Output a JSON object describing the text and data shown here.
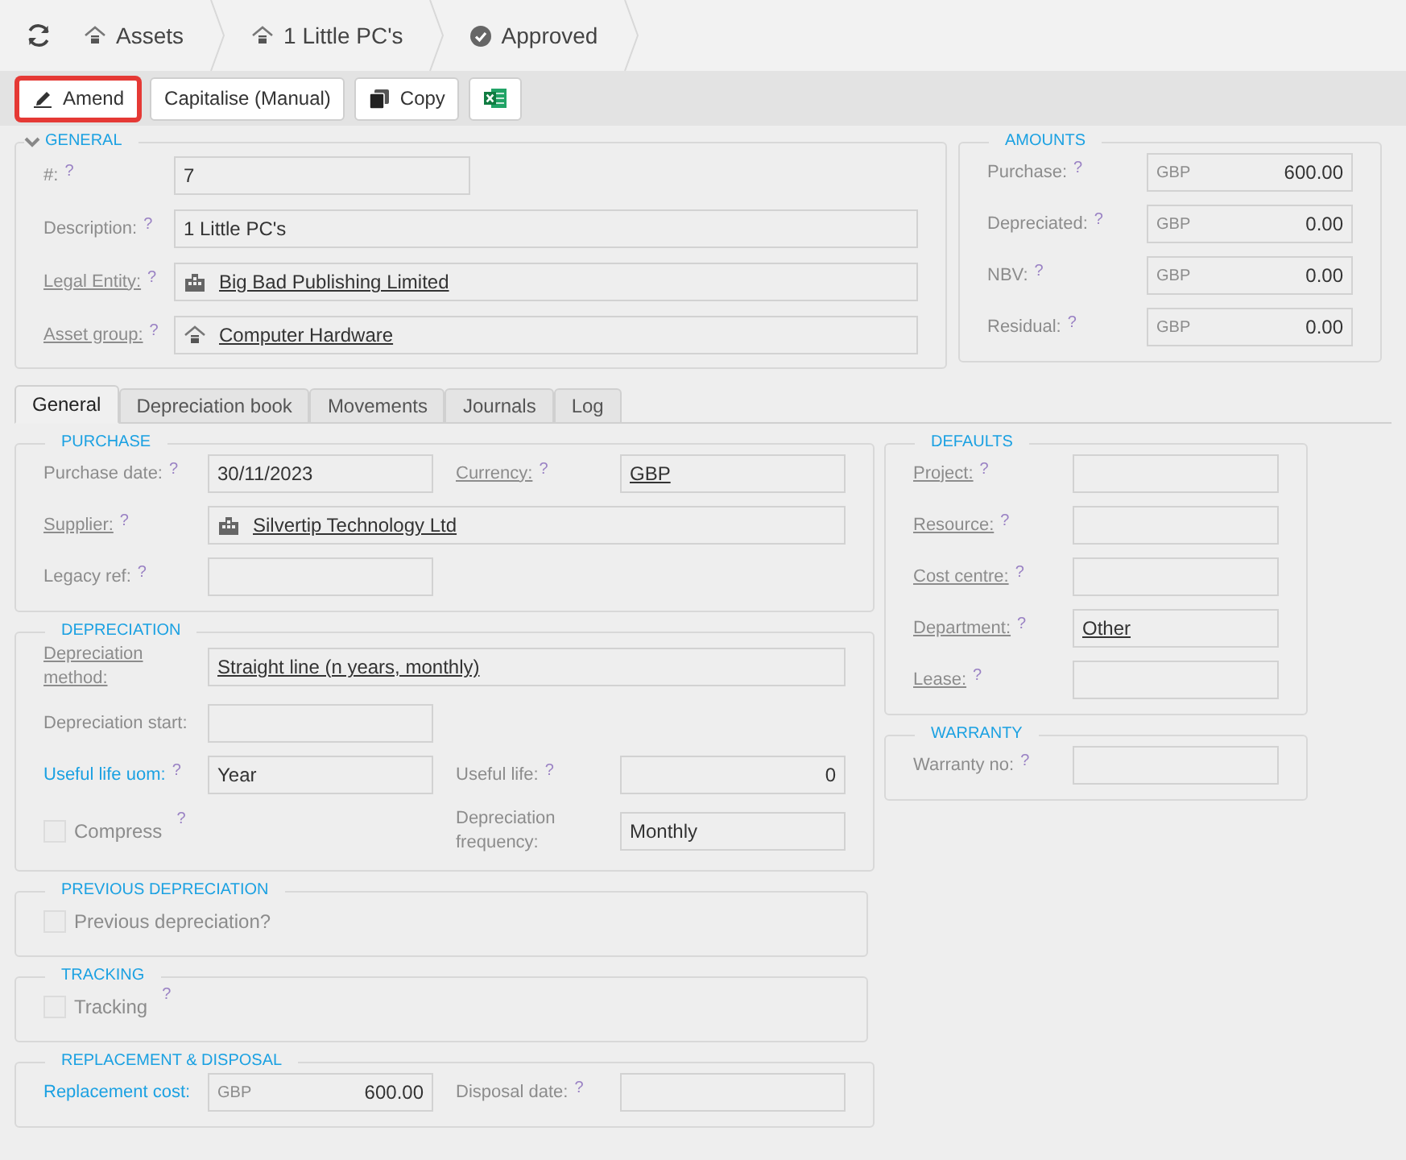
{
  "breadcrumbs": [
    {
      "kind": "module",
      "label": "Assets"
    },
    {
      "kind": "record",
      "label": "1 Little PC's"
    },
    {
      "kind": "status",
      "label": "Approved"
    }
  ],
  "toolbar": [
    {
      "kind": "amend",
      "label": "Amend",
      "highlighted": true
    },
    {
      "kind": "plain",
      "label": "Capitalise (Manual)",
      "highlighted": false
    },
    {
      "kind": "copy",
      "label": "Copy",
      "highlighted": false
    },
    {
      "kind": "excel",
      "highlighted": false
    }
  ],
  "general": {
    "title": "GENERAL",
    "fields": [
      {
        "kind": "text",
        "label": "#:",
        "linked": false,
        "required": false,
        "help": "?",
        "value": "7",
        "wide": false
      },
      {
        "kind": "text",
        "label": "Description:",
        "linked": false,
        "required": false,
        "help": "?",
        "value": "1 Little PC's",
        "wide": true
      },
      {
        "kind": "entity",
        "label": "Legal Entity:",
        "linked": true,
        "required": false,
        "help": "?",
        "value": "Big Bad Publishing Limited",
        "wide": true
      },
      {
        "kind": "category",
        "label": "Asset group:",
        "linked": true,
        "required": false,
        "help": "?",
        "value": "Computer Hardware",
        "wide": true
      }
    ]
  },
  "amounts": {
    "title": "AMOUNTS",
    "rows": [
      {
        "label": "Purchase:",
        "help": "?",
        "currency": "GBP",
        "value": "600.00"
      },
      {
        "label": "Depreciated:",
        "help": "?",
        "currency": "GBP",
        "value": "0.00"
      },
      {
        "label": "NBV:",
        "help": "?",
        "currency": "GBP",
        "value": "0.00"
      },
      {
        "label": "Residual:",
        "help": "?",
        "currency": "GBP",
        "value": "0.00"
      }
    ]
  },
  "tabs": [
    {
      "label": "General",
      "selected": true
    },
    {
      "label": "Depreciation book",
      "selected": false
    },
    {
      "label": "Movements",
      "selected": false
    },
    {
      "label": "Journals",
      "selected": false
    },
    {
      "label": "Log",
      "selected": false
    }
  ],
  "left_sections": [
    {
      "title": "PURCHASE",
      "rows": [
        [
          {
            "kind": "text",
            "label": "Purchase date:",
            "linked": false,
            "required": false,
            "help": "?",
            "value": "30/11/2023",
            "wide": false
          },
          {
            "kind": "lookup",
            "label": "Currency:",
            "linked": true,
            "required": false,
            "help": "?",
            "value": "GBP",
            "wide": false
          }
        ],
        [
          {
            "kind": "entity",
            "label": "Supplier:",
            "linked": true,
            "required": false,
            "help": "?",
            "value": "Silvertip Technology Ltd",
            "wide": true
          }
        ],
        [
          {
            "kind": "text",
            "label": "Legacy ref:",
            "linked": false,
            "required": false,
            "help": "?",
            "wide": false
          }
        ]
      ]
    },
    {
      "title": "DEPRECIATION",
      "rows": [
        [
          {
            "kind": "lookup",
            "label": "Depreciation method:",
            "linked": true,
            "required": false,
            "value": "Straight line (n years, monthly)",
            "wide": true
          }
        ],
        [
          {
            "kind": "text",
            "label": "Depreciation start:",
            "linked": false,
            "required": false,
            "wide": false
          }
        ],
        [
          {
            "kind": "text",
            "label": "Useful life uom:",
            "linked": false,
            "required": true,
            "help": "?",
            "value": "Year",
            "wide": false
          },
          {
            "kind": "number",
            "label": "Useful life:",
            "linked": false,
            "required": false,
            "help": "?",
            "value": "0",
            "wide": false
          }
        ],
        [
          {
            "kind": "checkbox",
            "label": "Compress",
            "help": "?",
            "checked": false
          },
          {
            "kind": "text",
            "label": "Depreciation frequency:",
            "linked": false,
            "required": false,
            "value": "Monthly",
            "wide": false
          }
        ]
      ]
    },
    {
      "title": "PREVIOUS DEPRECIATION",
      "rows": [
        [
          {
            "kind": "checkbox",
            "label": "Previous depreciation?",
            "checked": false
          }
        ]
      ]
    },
    {
      "title": "TRACKING",
      "rows": [
        [
          {
            "kind": "checkbox",
            "label": "Tracking",
            "help": "?",
            "checked": false
          }
        ]
      ]
    },
    {
      "title": "REPLACEMENT & DISPOSAL",
      "rows": [
        [
          {
            "kind": "money",
            "label": "Replacement cost:",
            "linked": false,
            "required": true,
            "currency": "GBP",
            "value": "600.00",
            "wide": false
          },
          {
            "kind": "text",
            "label": "Disposal date:",
            "linked": false,
            "required": false,
            "help": "?",
            "wide": false
          }
        ]
      ]
    }
  ],
  "right_sections": [
    {
      "title": "DEFAULTS",
      "rows": [
        [
          {
            "kind": "lookup",
            "label": "Project:",
            "linked": true,
            "required": false,
            "help": "?"
          }
        ],
        [
          {
            "kind": "lookup",
            "label": "Resource:",
            "linked": true,
            "required": false,
            "help": "?"
          }
        ],
        [
          {
            "kind": "lookup",
            "label": "Cost centre:",
            "linked": true,
            "required": false,
            "help": "?"
          }
        ],
        [
          {
            "kind": "lookup",
            "label": "Department:",
            "linked": true,
            "required": false,
            "help": "?",
            "value": "Other"
          }
        ],
        [
          {
            "kind": "lookup",
            "label": "Lease:",
            "linked": true,
            "required": false,
            "help": "?"
          }
        ]
      ]
    },
    {
      "title": "WARRANTY",
      "rows": [
        [
          {
            "kind": "text",
            "label": "Warranty no:",
            "linked": false,
            "required": false,
            "help": "?"
          }
        ]
      ]
    }
  ]
}
